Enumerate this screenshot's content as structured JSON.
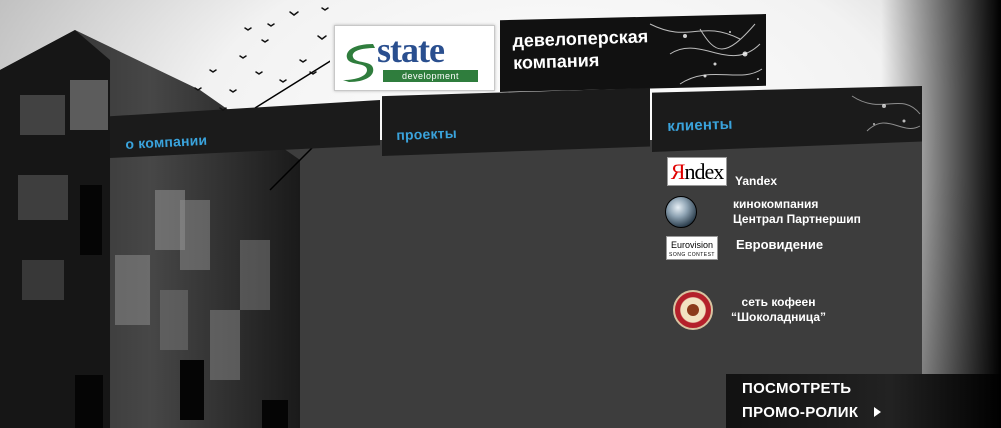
{
  "brand": {
    "logo_word": "state",
    "logo_sub": "development",
    "tagline_line1": "девелоперская",
    "tagline_line2": "компания"
  },
  "nav": {
    "about": "о компании",
    "projects": "проекты",
    "clients": "клиенты"
  },
  "clients": {
    "yandex_logo_first": "Я",
    "yandex_logo_rest": "ndex",
    "yandex": "Yandex",
    "central_line1": "кинокомпания",
    "central_line2": "Централ Партнершип",
    "euro_logo_top": "Eurovision",
    "euro_logo_bottom": "SONG CONTEST",
    "eurovision": "Евровидение",
    "choco_line1": "сеть кофеен",
    "choco_line2": "“Шоколадница”"
  },
  "promo": {
    "line1": "ПОСМОТРЕТЬ",
    "line2": "ПРОМО-РОЛИК"
  },
  "colors": {
    "accent": "#3aa3dc",
    "panel": "#3d3d3d",
    "tab": "#1b1b1b",
    "logo_blue": "#2a4f8f",
    "logo_green": "#2f7d3d"
  }
}
